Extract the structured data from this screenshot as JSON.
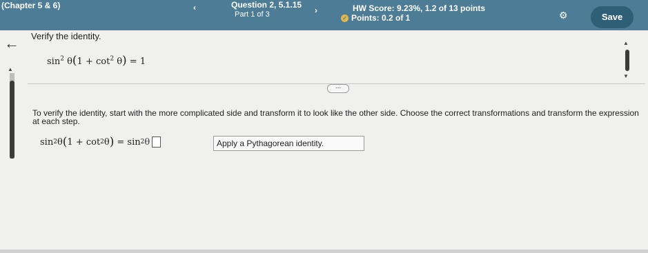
{
  "header": {
    "chapter": "(Chapter 5 & 6)",
    "prev_arrow": "‹",
    "question": "Question 2, 5.1.15",
    "part": "Part 1 of 3",
    "next_arrow": "›",
    "hw_score": "HW Score: 9.23%, 1.2 of 13 points",
    "points": "Points: 0.2 of 1",
    "save_label": "Save"
  },
  "content": {
    "title": "Verify the identity.",
    "identity": {
      "lhs_func": "sin",
      "exp": "2",
      "var": "θ",
      "one_plus": "1 + cot",
      "rhs": "= 1"
    },
    "instructions": "To verify the identity, start with the more complicated side and transform it to look like the other side. Choose the correct transformations and transform the expression at each step.",
    "step": {
      "lhs_func": "sin",
      "exp": "2",
      "var": "θ",
      "one_plus": "1 + cot",
      "equals": "= sin",
      "selected_option": "Apply a Pythagorean identity."
    },
    "more_label": "..."
  },
  "icons": {
    "back": "back-arrow-icon",
    "gear": "gear-icon",
    "points_status": "partial-credit-icon"
  },
  "colors": {
    "header_bg": "#4d7d96",
    "save_bg": "#2f5e77",
    "points_icon": "#e3b64a"
  }
}
